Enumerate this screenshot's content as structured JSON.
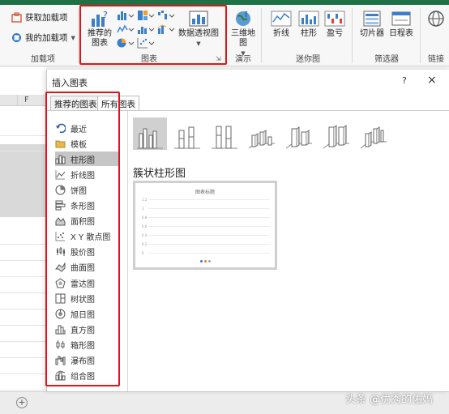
{
  "ribbon": {
    "addins": {
      "get_addins_label": "获取加载项",
      "my_addins_label": "我的加载项",
      "group_label": "加载项"
    },
    "charts": {
      "recommended_label_line1": "推荐的",
      "recommended_label_line2": "图表",
      "pivot_chart_label": "数据透视图",
      "group_label": "图表"
    },
    "tours": {
      "map3d_line1": "三维地",
      "map3d_line2": "图",
      "group_label": "演示"
    },
    "sparklines": {
      "line_label": "折线",
      "column_label": "柱形",
      "winloss_label": "盈亏",
      "group_label": "迷你图"
    },
    "filters": {
      "slicer_label": "切片器",
      "timeline_label": "日程表",
      "group_label": "筛选器"
    },
    "links": {
      "group_label": "链接"
    },
    "colors": {
      "highlight": "#e0151b",
      "accent_green": "#1e7145"
    }
  },
  "sheet": {
    "column_f": "F"
  },
  "dialog": {
    "title": "插入图表",
    "help": "?",
    "close": "×",
    "tabs": {
      "recommended": "推荐的图表",
      "all": "所有图表"
    },
    "chart_types": [
      {
        "label": "最近",
        "icon": "undo-arrow-icon"
      },
      {
        "label": "模板",
        "icon": "folder-icon"
      },
      {
        "label": "柱形图",
        "icon": "column-chart-icon"
      },
      {
        "label": "折线图",
        "icon": "line-chart-icon"
      },
      {
        "label": "饼图",
        "icon": "pie-chart-icon"
      },
      {
        "label": "条形图",
        "icon": "bar-chart-icon"
      },
      {
        "label": "面积图",
        "icon": "area-chart-icon"
      },
      {
        "label": "X Y 散点图",
        "icon": "scatter-chart-icon"
      },
      {
        "label": "股价图",
        "icon": "stock-chart-icon"
      },
      {
        "label": "曲面图",
        "icon": "surface-chart-icon"
      },
      {
        "label": "雷达图",
        "icon": "radar-chart-icon"
      },
      {
        "label": "树状图",
        "icon": "treemap-chart-icon"
      },
      {
        "label": "旭日图",
        "icon": "sunburst-chart-icon"
      },
      {
        "label": "直方图",
        "icon": "histogram-chart-icon"
      },
      {
        "label": "箱形图",
        "icon": "boxplot-chart-icon"
      },
      {
        "label": "瀑布图",
        "icon": "waterfall-chart-icon"
      },
      {
        "label": "组合图",
        "icon": "combo-chart-icon"
      }
    ],
    "selected_type": "柱形图",
    "subtype_title": "簇状柱形图",
    "preview": {
      "title": "图表标题",
      "axis_values": [
        "1.2",
        "1",
        "0.8",
        "0.6",
        "0.4",
        "0.2",
        "0"
      ]
    }
  },
  "watermark": "头条 @优秀的佑妈"
}
